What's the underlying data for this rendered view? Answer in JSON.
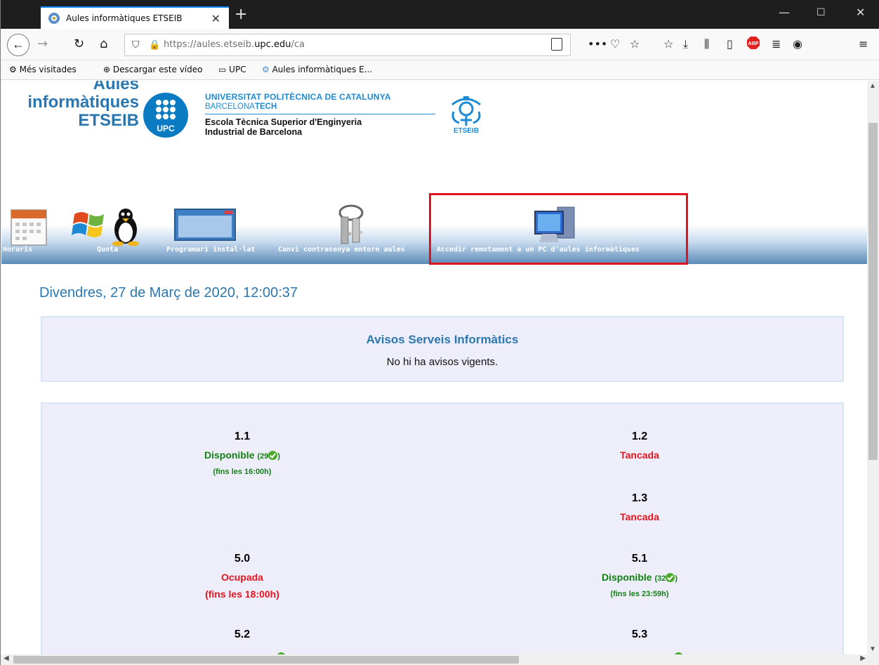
{
  "browser": {
    "tab_title": "Aules informàtiques ETSEIB",
    "tab_close": "✕",
    "new_tab": "+",
    "url_prefix": "https://aules.etseib.",
    "url_domain": "upc.edu",
    "url_suffix": "/ca",
    "bookmarks": [
      "Més visitades",
      "Descargar este vídeo",
      "UPC",
      "Aules informàtiques E..."
    ]
  },
  "header": {
    "site_title_1": "Aules",
    "site_title_2": "informàtiques",
    "site_title_3": "ETSEIB",
    "upc_line1": "UNIVERSITAT POLITÈCNICA DE CATALUNYA",
    "upc_line2_a": "BARCELONA",
    "upc_line2_b": "TECH",
    "school_line1": "Escola Tècnica Superior d'Enginyeria",
    "school_line2": "Industrial de Barcelona",
    "upc_logo_text": "UPC",
    "seal_text": "ETSEIB"
  },
  "menu": {
    "items": [
      {
        "label": "Horaris"
      },
      {
        "label": "Quota"
      },
      {
        "label": "Programari instal·lat"
      },
      {
        "label": "Canvi contrasenya entorn aules"
      },
      {
        "label": "Accedir remotament a un PC d'aules informàtiques"
      }
    ]
  },
  "date": "Divendres, 27 de Març de 2020, 12:00:37",
  "avisos": {
    "title": "Avisos Serveis Informàtics",
    "text": "No hi ha avisos vigents."
  },
  "rooms": [
    {
      "num": "1.1",
      "status": "Disponible",
      "count": "(29",
      "count_close": ")",
      "sub": "(fins les 16:00h)",
      "color": "#128012"
    },
    {
      "num": "1.2",
      "status": "Tancada",
      "color": "#e3141e"
    },
    {
      "num": "1.3",
      "status": "Tancada",
      "color": "#e3141e"
    },
    {
      "num": "5.0",
      "status": "Ocupada",
      "sub": "(fins les 18:00h)",
      "color": "#e3141e"
    },
    {
      "num": "5.1",
      "status": "Disponible",
      "count": "(32",
      "count_close": ")",
      "sub": "(fins les 23:59h)",
      "color": "#128012"
    },
    {
      "num": "5.2"
    },
    {
      "num": "5.3"
    }
  ]
}
